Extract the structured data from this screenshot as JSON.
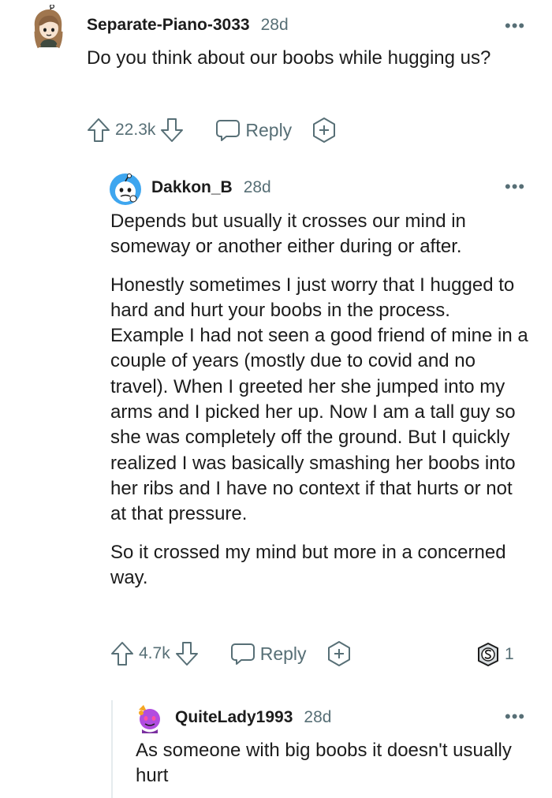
{
  "comments": [
    {
      "username": "Separate-Piano-3033",
      "age": "28d",
      "paragraphs": [
        "Do you think about our boobs while hugging us?"
      ],
      "votes": "22.3k",
      "reply_label": "Reply",
      "avatar_icon": "avatar-girl-icon"
    },
    {
      "username": "Dakkon_B",
      "age": "28d",
      "paragraphs": [
        "Depends but usually it crosses our mind in someway or another either during or after.",
        "Honestly sometimes I just worry that I hugged to hard and hurt your boobs in the process. Example I had not seen a good friend of mine in a couple of years (mostly due to covid and no travel). When I greeted her she jumped into my arms and I picked her up. Now I am a tall guy so she was completely off the ground. But I quickly realized I was basically smashing her boobs into her ribs and I have no context if that hurts or not at that pressure.",
        "So it crossed my mind but more in a concerned way."
      ],
      "votes": "4.7k",
      "reply_label": "Reply",
      "award_count": "1",
      "avatar_icon": "avatar-snoo-thinking-icon",
      "award_icon": "silver-award-icon"
    },
    {
      "username": "QuiteLady1993",
      "age": "28d",
      "paragraphs": [
        "As someone with big boobs it doesn't usually hurt"
      ],
      "avatar_icon": "avatar-purple-snoo-icon"
    }
  ],
  "colors": {
    "text": "#1c1c1c",
    "meta": "#576f76",
    "thread_line": "#e5ebee",
    "snoo_blue": "#3ea6ef",
    "purple": "#b14de0"
  }
}
